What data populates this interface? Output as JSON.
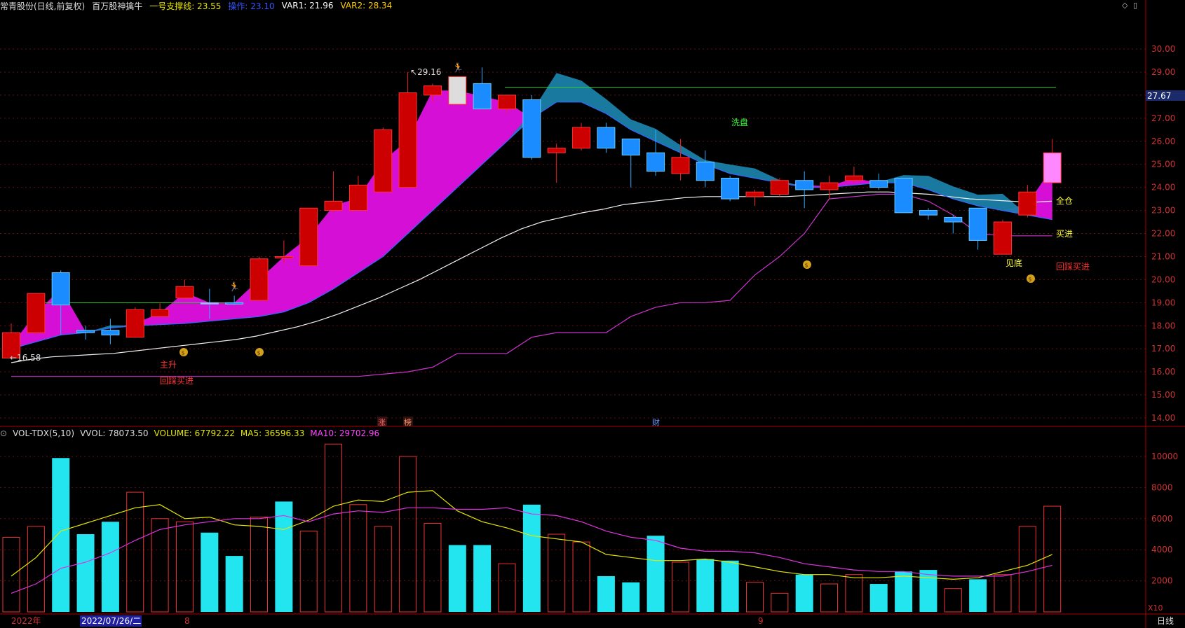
{
  "header": {
    "stock_name": "常青股份(日线,前复权)",
    "indicator_name": "百万股神擒牛",
    "support_label": "一号支撑线: 23.55",
    "operate_label": "操作: 23.10",
    "var1_label": "VAR1: 21.96",
    "var2_label": "VAR2: 28.34",
    "colors": {
      "support": "#e6e600",
      "operate": "#3355ff",
      "var1": "#ffffff",
      "var2": "#ffcc00"
    }
  },
  "volume_header": {
    "indicator": "VOL-TDX(5,10)",
    "vvol": "VVOL: 78073.50",
    "volume": "VOLUME: 67792.22",
    "ma5": "MA5: 36596.33",
    "ma10": "MA10: 29702.96",
    "colors": {
      "indicator": "#dddddd",
      "vvol": "#dddddd",
      "volume": "#e6e600",
      "ma5": "#e6e600",
      "ma10": "#ff44ff"
    }
  },
  "right_axis": {
    "current_price": "27.67",
    "price_ticks": [
      "30.00",
      "29.00",
      "28.00",
      "27.00",
      "26.00",
      "25.00",
      "24.00",
      "23.00",
      "22.00",
      "21.00",
      "20.00",
      "19.00",
      "18.00",
      "17.00",
      "16.00",
      "15.00",
      "14.00"
    ],
    "volume_ticks": [
      "10000",
      "8000",
      "6000",
      "4000",
      "2000"
    ],
    "multiplier": "X10"
  },
  "bottom_bar": {
    "year": "2022年",
    "cursor_date": "2022/07/26/二",
    "month_8": "8",
    "month_9": "9",
    "period": "日线"
  },
  "event_tags": {
    "limit_up": "涨",
    "top_list": "榜",
    "finance": "财"
  },
  "annotations": {
    "max_price": "29.16",
    "min_price": "16.58",
    "xipan": "洗盘",
    "quancang": "全仓",
    "maijin": "买进",
    "jiandi": "见底",
    "huicai_right": "回踩买进",
    "zhusheng": "主升",
    "huicai_left": "回踩买进"
  },
  "chart_data": {
    "type": "candlestick",
    "price_ylim": [
      14,
      30
    ],
    "volume_ylim": [
      0,
      11000
    ],
    "candles": [
      {
        "o": 17.7,
        "h": 18.1,
        "l": 16.6,
        "c": 16.6,
        "up": true
      },
      {
        "o": 17.7,
        "h": 19.4,
        "l": 17.6,
        "c": 19.4,
        "up": true
      },
      {
        "o": 20.3,
        "h": 20.4,
        "l": 17.6,
        "c": 18.9,
        "up": false
      },
      {
        "o": 17.8,
        "h": 18.0,
        "l": 17.4,
        "c": 17.7,
        "up": false
      },
      {
        "o": 17.8,
        "h": 18.3,
        "l": 17.2,
        "c": 17.6,
        "up": false
      },
      {
        "o": 17.5,
        "h": 18.8,
        "l": 17.5,
        "c": 18.7,
        "up": true
      },
      {
        "o": 18.7,
        "h": 19.0,
        "l": 18.4,
        "c": 18.4,
        "up": true
      },
      {
        "o": 19.2,
        "h": 20.0,
        "l": 19.1,
        "c": 19.7,
        "up": true
      },
      {
        "o": 19.0,
        "h": 19.6,
        "l": 18.3,
        "c": 19.0,
        "up": false
      },
      {
        "o": 19.0,
        "h": 19.3,
        "l": 18.9,
        "c": 19.0,
        "up": false
      },
      {
        "o": 19.1,
        "h": 21.0,
        "l": 19.1,
        "c": 20.9,
        "up": true
      },
      {
        "o": 21.0,
        "h": 21.7,
        "l": 20.7,
        "c": 21.0,
        "up": true
      },
      {
        "o": 20.6,
        "h": 23.1,
        "l": 20.6,
        "c": 23.1,
        "up": true
      },
      {
        "o": 23.0,
        "h": 24.7,
        "l": 22.9,
        "c": 23.4,
        "up": true
      },
      {
        "o": 23.0,
        "h": 24.5,
        "l": 23.0,
        "c": 24.1,
        "up": true
      },
      {
        "o": 23.8,
        "h": 26.6,
        "l": 23.8,
        "c": 26.5,
        "up": true
      },
      {
        "o": 24.0,
        "h": 29.0,
        "l": 24.0,
        "c": 28.1,
        "up": true
      },
      {
        "o": 28.0,
        "h": 28.5,
        "l": 27.7,
        "c": 28.4,
        "up": true
      },
      {
        "o": 28.8,
        "h": 28.8,
        "l": 27.6,
        "c": 27.6,
        "up": true
      },
      {
        "o": 28.5,
        "h": 29.2,
        "l": 27.4,
        "c": 27.4,
        "up": false
      },
      {
        "o": 27.4,
        "h": 28.0,
        "l": 27.2,
        "c": 28.0,
        "up": true
      },
      {
        "o": 27.8,
        "h": 28.0,
        "l": 25.2,
        "c": 25.3,
        "up": false
      },
      {
        "o": 25.5,
        "h": 25.9,
        "l": 24.2,
        "c": 25.7,
        "up": true
      },
      {
        "o": 25.7,
        "h": 26.8,
        "l": 25.6,
        "c": 26.6,
        "up": true
      },
      {
        "o": 26.6,
        "h": 26.8,
        "l": 25.5,
        "c": 25.7,
        "up": false
      },
      {
        "o": 26.1,
        "h": 26.1,
        "l": 24.0,
        "c": 25.4,
        "up": false
      },
      {
        "o": 25.5,
        "h": 26.5,
        "l": 24.5,
        "c": 24.7,
        "up": false
      },
      {
        "o": 24.6,
        "h": 26.1,
        "l": 24.3,
        "c": 25.3,
        "up": true
      },
      {
        "o": 25.1,
        "h": 25.6,
        "l": 24.0,
        "c": 24.3,
        "up": false
      },
      {
        "o": 24.4,
        "h": 24.5,
        "l": 23.4,
        "c": 23.5,
        "up": false
      },
      {
        "o": 23.6,
        "h": 23.9,
        "l": 23.2,
        "c": 23.8,
        "up": true
      },
      {
        "o": 23.7,
        "h": 24.4,
        "l": 23.6,
        "c": 24.3,
        "up": true
      },
      {
        "o": 24.3,
        "h": 24.7,
        "l": 23.1,
        "c": 23.9,
        "up": false
      },
      {
        "o": 23.9,
        "h": 24.5,
        "l": 23.5,
        "c": 24.2,
        "up": true
      },
      {
        "o": 24.3,
        "h": 24.9,
        "l": 24.2,
        "c": 24.5,
        "up": true
      },
      {
        "o": 24.3,
        "h": 24.6,
        "l": 23.9,
        "c": 24.0,
        "up": false
      },
      {
        "o": 24.4,
        "h": 24.4,
        "l": 22.9,
        "c": 22.9,
        "up": false
      },
      {
        "o": 23.0,
        "h": 23.1,
        "l": 22.6,
        "c": 22.8,
        "up": false
      },
      {
        "o": 22.7,
        "h": 22.8,
        "l": 22.0,
        "c": 22.5,
        "up": false
      },
      {
        "o": 23.1,
        "h": 23.1,
        "l": 21.3,
        "c": 21.7,
        "up": false
      },
      {
        "o": 21.1,
        "h": 22.6,
        "l": 21.1,
        "c": 22.5,
        "up": true
      },
      {
        "o": 22.8,
        "h": 24.1,
        "l": 22.7,
        "c": 23.8,
        "up": true
      },
      {
        "o": 24.2,
        "h": 26.1,
        "l": 24.2,
        "c": 25.5,
        "up": true
      }
    ],
    "special_candles": [
      8,
      18,
      42
    ],
    "ma_white": [
      16.4,
      16.55,
      16.65,
      16.7,
      16.75,
      16.8,
      16.9,
      17.0,
      17.1,
      17.2,
      17.3,
      17.4,
      17.55,
      17.75,
      17.95,
      18.2,
      18.5,
      18.85,
      19.2,
      19.6,
      20.0,
      20.45,
      20.9,
      21.35,
      21.8,
      22.2,
      22.5,
      22.7,
      22.9,
      23.05,
      23.25,
      23.35,
      23.45,
      23.55,
      23.6,
      23.6,
      23.6,
      23.6,
      23.6,
      23.65,
      23.7,
      23.75,
      23.8,
      23.8,
      23.75,
      23.7,
      23.6,
      23.5,
      23.45,
      23.4,
      23.35,
      23.4
    ],
    "ma_blue": [
      17.0,
      17.3,
      17.6,
      17.7,
      17.9,
      18.0,
      18.05,
      18.1,
      18.2,
      18.3,
      18.4,
      18.6,
      19.0,
      19.6,
      20.3,
      21.0,
      22.0,
      23.0,
      24.0,
      25.0,
      26.0,
      27.0,
      27.7,
      27.7,
      27.2,
      26.5,
      26.0,
      25.5,
      25.0,
      24.6,
      24.4,
      24.2,
      24.0,
      24.0,
      24.1,
      24.2,
      24.2,
      23.9,
      23.5,
      23.2,
      23.0,
      22.8,
      22.6
    ],
    "ma_magenta": [
      15.8,
      15.8,
      15.8,
      15.8,
      15.8,
      15.8,
      15.8,
      15.8,
      15.8,
      15.8,
      15.8,
      15.8,
      15.8,
      15.8,
      15.8,
      15.9,
      16.0,
      16.2,
      16.8,
      16.8,
      16.8,
      17.5,
      17.7,
      17.7,
      17.7,
      18.4,
      18.8,
      19.0,
      19.0,
      19.1,
      20.2,
      21.0,
      22.0,
      23.5,
      23.6,
      23.7,
      23.7,
      23.4,
      22.8,
      22.0,
      21.9,
      21.9,
      21.9
    ],
    "support_line": 28.34,
    "volume": [
      {
        "v": 4800,
        "up": true
      },
      {
        "v": 5500,
        "up": true
      },
      {
        "v": 9900,
        "up": false
      },
      {
        "v": 5000,
        "up": false
      },
      {
        "v": 5800,
        "up": false
      },
      {
        "v": 7700,
        "up": true
      },
      {
        "v": 6000,
        "up": true
      },
      {
        "v": 5800,
        "up": true
      },
      {
        "v": 5100,
        "up": false
      },
      {
        "v": 3600,
        "up": false
      },
      {
        "v": 6100,
        "up": true
      },
      {
        "v": 7100,
        "up": false
      },
      {
        "v": 5200,
        "up": true
      },
      {
        "v": 10800,
        "up": true
      },
      {
        "v": 6900,
        "up": true
      },
      {
        "v": 5500,
        "up": true
      },
      {
        "v": 10000,
        "up": true
      },
      {
        "v": 5700,
        "up": true
      },
      {
        "v": 4300,
        "up": false
      },
      {
        "v": 4300,
        "up": false
      },
      {
        "v": 3100,
        "up": true
      },
      {
        "v": 6900,
        "up": false
      },
      {
        "v": 5000,
        "up": true
      },
      {
        "v": 4500,
        "up": true
      },
      {
        "v": 2300,
        "up": false
      },
      {
        "v": 1900,
        "up": false
      },
      {
        "v": 4900,
        "up": false
      },
      {
        "v": 3200,
        "up": true
      },
      {
        "v": 3400,
        "up": false
      },
      {
        "v": 3300,
        "up": false
      },
      {
        "v": 1900,
        "up": true
      },
      {
        "v": 1200,
        "up": true
      },
      {
        "v": 2400,
        "up": false
      },
      {
        "v": 1800,
        "up": true
      },
      {
        "v": 2400,
        "up": true
      },
      {
        "v": 1800,
        "up": false
      },
      {
        "v": 2600,
        "up": false
      },
      {
        "v": 2700,
        "up": false
      },
      {
        "v": 1500,
        "up": true
      },
      {
        "v": 2100,
        "up": false
      },
      {
        "v": 2400,
        "up": true
      },
      {
        "v": 5500,
        "up": true
      },
      {
        "v": 6800,
        "up": true
      }
    ],
    "vol_ma5": [
      2300,
      3500,
      5200,
      5700,
      6200,
      6700,
      6900,
      6000,
      6100,
      5600,
      5500,
      5300,
      5900,
      6800,
      7200,
      7100,
      7700,
      7800,
      6500,
      5800,
      5400,
      4900,
      4700,
      4500,
      3700,
      3500,
      3300,
      3300,
      3400,
      3200,
      2900,
      2600,
      2400,
      2400,
      2200,
      2200,
      2300,
      2200,
      2100,
      2200,
      2600,
      3000,
      3700
    ],
    "vol_ma10": [
      1200,
      1800,
      2800,
      3200,
      3800,
      4600,
      5300,
      5600,
      5800,
      6000,
      6000,
      6200,
      5800,
      6300,
      6500,
      6400,
      6700,
      6700,
      6600,
      6600,
      6700,
      6300,
      6200,
      5800,
      5200,
      4800,
      4600,
      4100,
      3900,
      3900,
      3800,
      3500,
      3100,
      2900,
      2700,
      2600,
      2600,
      2400,
      2300,
      2300,
      2300,
      2600,
      3000
    ]
  }
}
